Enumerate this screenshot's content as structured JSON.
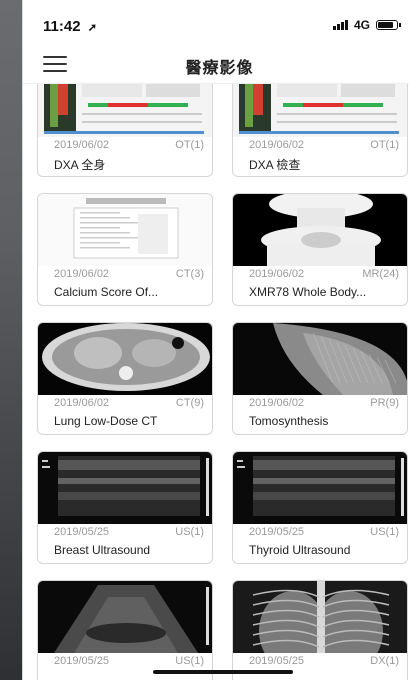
{
  "status_bar": {
    "time": "11:42",
    "network": "4G"
  },
  "header": {
    "title": "醫療影像"
  },
  "studies": [
    {
      "date": "2019/06/02",
      "modality": "OT(1)",
      "title": "DXA 全身",
      "thumb": "dxa-report"
    },
    {
      "date": "2019/06/02",
      "modality": "OT(1)",
      "title": "DXA 檢查",
      "thumb": "dxa-report"
    },
    {
      "date": "2019/06/02",
      "modality": "CT(3)",
      "title": "Calcium Score  Of...",
      "thumb": "document"
    },
    {
      "date": "2019/06/02",
      "modality": "MR(24)",
      "title": "XMR78 Whole Body...",
      "thumb": "mr-scan"
    },
    {
      "date": "2019/06/02",
      "modality": "CT(9)",
      "title": "Lung Low-Dose CT",
      "thumb": "ct-scan"
    },
    {
      "date": "2019/06/02",
      "modality": "PR(9)",
      "title": "Tomosynthesis",
      "thumb": "mammo"
    },
    {
      "date": "2019/05/25",
      "modality": "US(1)",
      "title": "Breast Ultrasound",
      "thumb": "ultrasound"
    },
    {
      "date": "2019/05/25",
      "modality": "US(1)",
      "title": "Thyroid Ultrasound",
      "thumb": "ultrasound"
    },
    {
      "date": "2019/05/25",
      "modality": "US(1)",
      "title": "",
      "thumb": "ultrasound-fan"
    },
    {
      "date": "2019/05/25",
      "modality": "DX(1)",
      "title": "",
      "thumb": "xray"
    }
  ]
}
